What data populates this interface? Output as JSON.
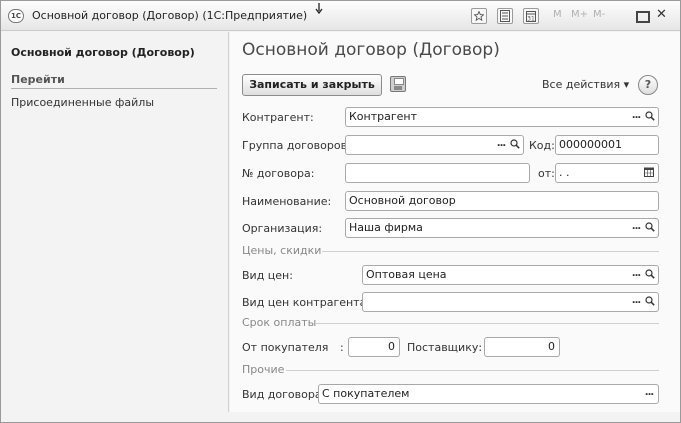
{
  "window": {
    "title": "Основной договор (Договор) (1С:Предприятие)",
    "app_icon_text": "1С",
    "memory_buttons": [
      "M",
      "M+",
      "M-"
    ]
  },
  "left_panel": {
    "title": "Основной договор (Договор)",
    "section": "Перейти",
    "items": [
      "Присоединенные файлы"
    ]
  },
  "form": {
    "title": "Основной договор (Договор)",
    "save_close_label": "Записать и закрыть",
    "all_actions_label": "Все действия ▾",
    "help_label": "?",
    "fields": {
      "counterparty": {
        "label": "Контрагент:",
        "value": "Контрагент"
      },
      "contract_group": {
        "label": "Группа договоров:",
        "value": ""
      },
      "code": {
        "label": "Код:",
        "value": "000000001"
      },
      "contract_number": {
        "label": "№ договора:",
        "value": ""
      },
      "date_from": {
        "label": "от:",
        "value": " .  ."
      },
      "name": {
        "label": "Наименование:",
        "value": "Основной договор"
      },
      "organization": {
        "label": "Организация:",
        "value": "Наша фирма"
      },
      "price_type": {
        "label": "Вид цен:",
        "value": "Оптовая цена"
      },
      "counterparty_price_type": {
        "label": "Вид цен контрагента:",
        "value": ""
      },
      "from_buyer": {
        "label": "От покупателя",
        "colon": ":",
        "value": "0"
      },
      "to_supplier": {
        "label": "Поставщику:",
        "value": "0"
      },
      "contract_kind": {
        "label": "Вид договора:",
        "value": "С покупателем"
      }
    },
    "sections": {
      "prices": "Цены, скидки",
      "payment_term": "Срок оплаты",
      "other": "Прочие"
    }
  }
}
